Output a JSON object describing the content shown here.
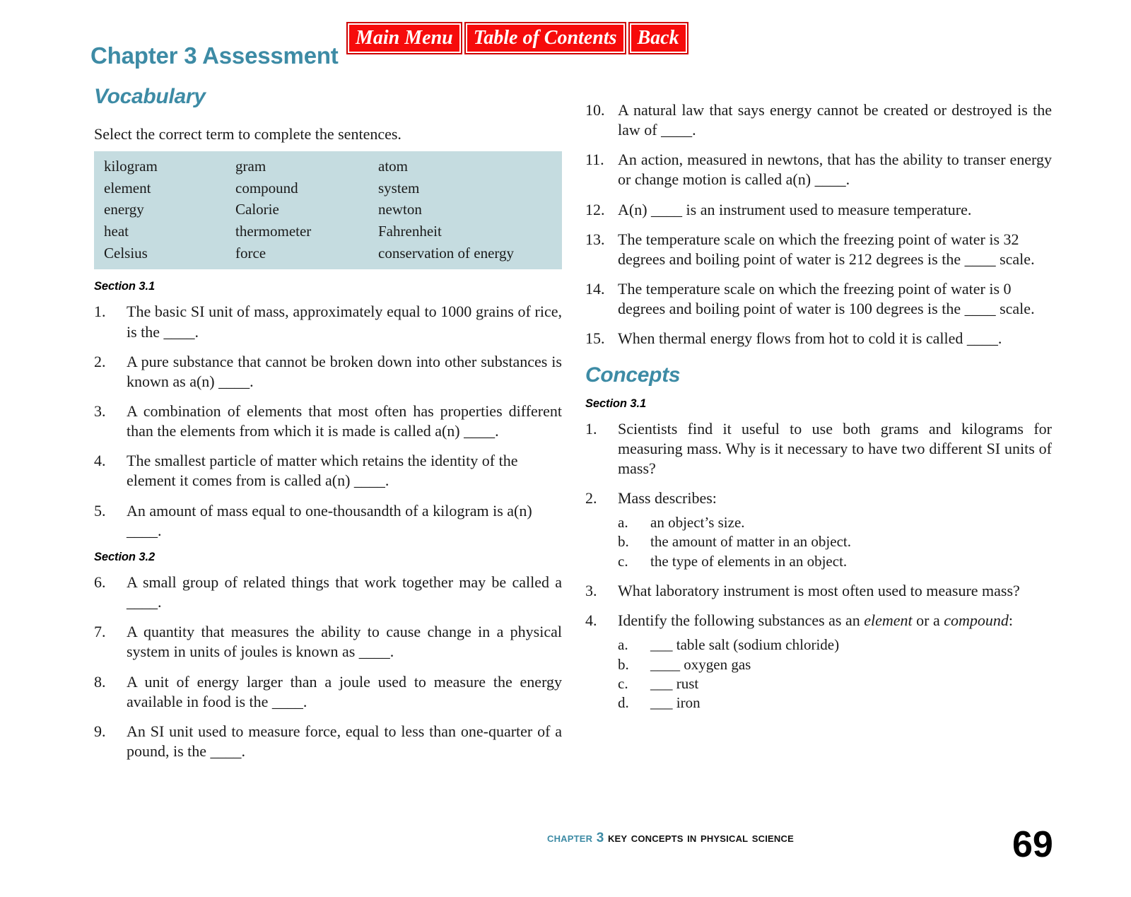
{
  "header": {
    "title": "Chapter 3 Assessment",
    "nav_buttons": [
      {
        "label": "Main Menu",
        "name": "main-menu"
      },
      {
        "label": "Table of Contents",
        "name": "table-of-contents"
      },
      {
        "label": "Back",
        "name": "back"
      }
    ],
    "title_color": "#3d8ba5",
    "button_color": "#f60b0b"
  },
  "vocabulary": {
    "heading": "Vocabulary",
    "instruction": "Select the correct term to complete the sentences.",
    "word_bank_bg": "#c5dce0",
    "word_bank": [
      [
        "kilogram",
        "gram",
        "atom"
      ],
      [
        "element",
        "compound",
        "system"
      ],
      [
        "energy",
        "Calorie",
        "newton"
      ],
      [
        "heat",
        "thermometer",
        "Fahrenheit"
      ],
      [
        "Celsius",
        "force",
        "conservation of energy"
      ]
    ],
    "sections": [
      {
        "label": "Section 3.1",
        "questions": [
          {
            "num": "1.",
            "text": "The basic SI unit of mass, approximately equal to 1000 grains of rice, is the ____.",
            "justify": true
          },
          {
            "num": "2.",
            "text": "A pure substance that cannot be broken down into other substances is known as a(n) ____.",
            "justify": true
          },
          {
            "num": "3.",
            "text": "A combination of elements that most often has properties different than the elements from which it is made is called a(n) ____.",
            "justify": true
          },
          {
            "num": "4.",
            "text": "The smallest particle of matter which retains the identity of the element it comes from is called a(n) ____.",
            "justify": false
          },
          {
            "num": "5.",
            "text": "An amount of mass equal to one-thousandth of a kilogram is a(n) ____.",
            "justify": false
          }
        ]
      },
      {
        "label": "Section 3.2",
        "questions": [
          {
            "num": "6.",
            "text": "A small group of related things that work together may be called a ____.",
            "justify": true
          },
          {
            "num": "7.",
            "text": "A quantity that measures the ability to cause change in a physical system in units of joules is known as ____.",
            "justify": true
          },
          {
            "num": "8.",
            "text": "A unit of energy larger than a joule used to measure the energy available in food is the ____.",
            "justify": true
          },
          {
            "num": "9.",
            "text": "An SI unit used to measure force, equal to less than one-quarter of a pound, is the ____.",
            "justify": true
          }
        ]
      }
    ],
    "continued_questions": [
      {
        "num": "10.",
        "text": "A natural law that says energy cannot be created or destroyed is the law of ____.",
        "justify": true
      },
      {
        "num": "11.",
        "text": "An action, measured in newtons, that has the ability to transer energy or change motion is called a(n) ____.",
        "justify": true
      },
      {
        "num": "12.",
        "text": "A(n) ____ is an instrument used to measure temperature.",
        "justify": false
      },
      {
        "num": "13.",
        "text": "The temperature scale on which the freezing point of water is 32 degrees and boiling point of water is 212 degrees is the ____ scale.",
        "justify": false
      },
      {
        "num": "14.",
        "text": "The temperature scale on which the freezing point of water is 0 degrees and boiling point of water is 100 degrees is the ____ scale.",
        "justify": false
      },
      {
        "num": "15.",
        "text": "When thermal energy flows from hot to cold it is called ____.",
        "justify": false
      }
    ]
  },
  "concepts": {
    "heading": "Concepts",
    "section_label": "Section 3.1",
    "questions": [
      {
        "num": "1.",
        "text": "Scientists find it useful to use both grams and kilograms for measuring mass. Why is it necessary to have two different SI units of mass?",
        "justify": true,
        "subitems": []
      },
      {
        "num": "2.",
        "text": "Mass describes:",
        "justify": false,
        "subitems": [
          {
            "letter": "a.",
            "text": "an object’s size."
          },
          {
            "letter": "b.",
            "text": "the amount of matter in an object."
          },
          {
            "letter": "c.",
            "text": "the type of elements in an object."
          }
        ]
      },
      {
        "num": "3.",
        "text": "What laboratory instrument is most often used to measure mass?",
        "justify": true,
        "subitems": []
      },
      {
        "num": "4.",
        "text": "Identify the following substances as an element or a compound:",
        "text_html": "Identify the following substances as an <i>element</i> or a <i>compound</i>:",
        "justify": true,
        "subitems": [
          {
            "letter": "a.",
            "text": "___ table salt (sodium chloride)"
          },
          {
            "letter": "b.",
            "text": "____ oxygen gas"
          },
          {
            "letter": "c.",
            "text": "___ rust"
          },
          {
            "letter": "d.",
            "text": "___ iron"
          }
        ]
      }
    ]
  },
  "footer": {
    "chapter_label": "Chapter 3",
    "book_title": "Key Concepts in Physical Science",
    "page_number": "69",
    "chapter_color": "#3d8ba5"
  }
}
